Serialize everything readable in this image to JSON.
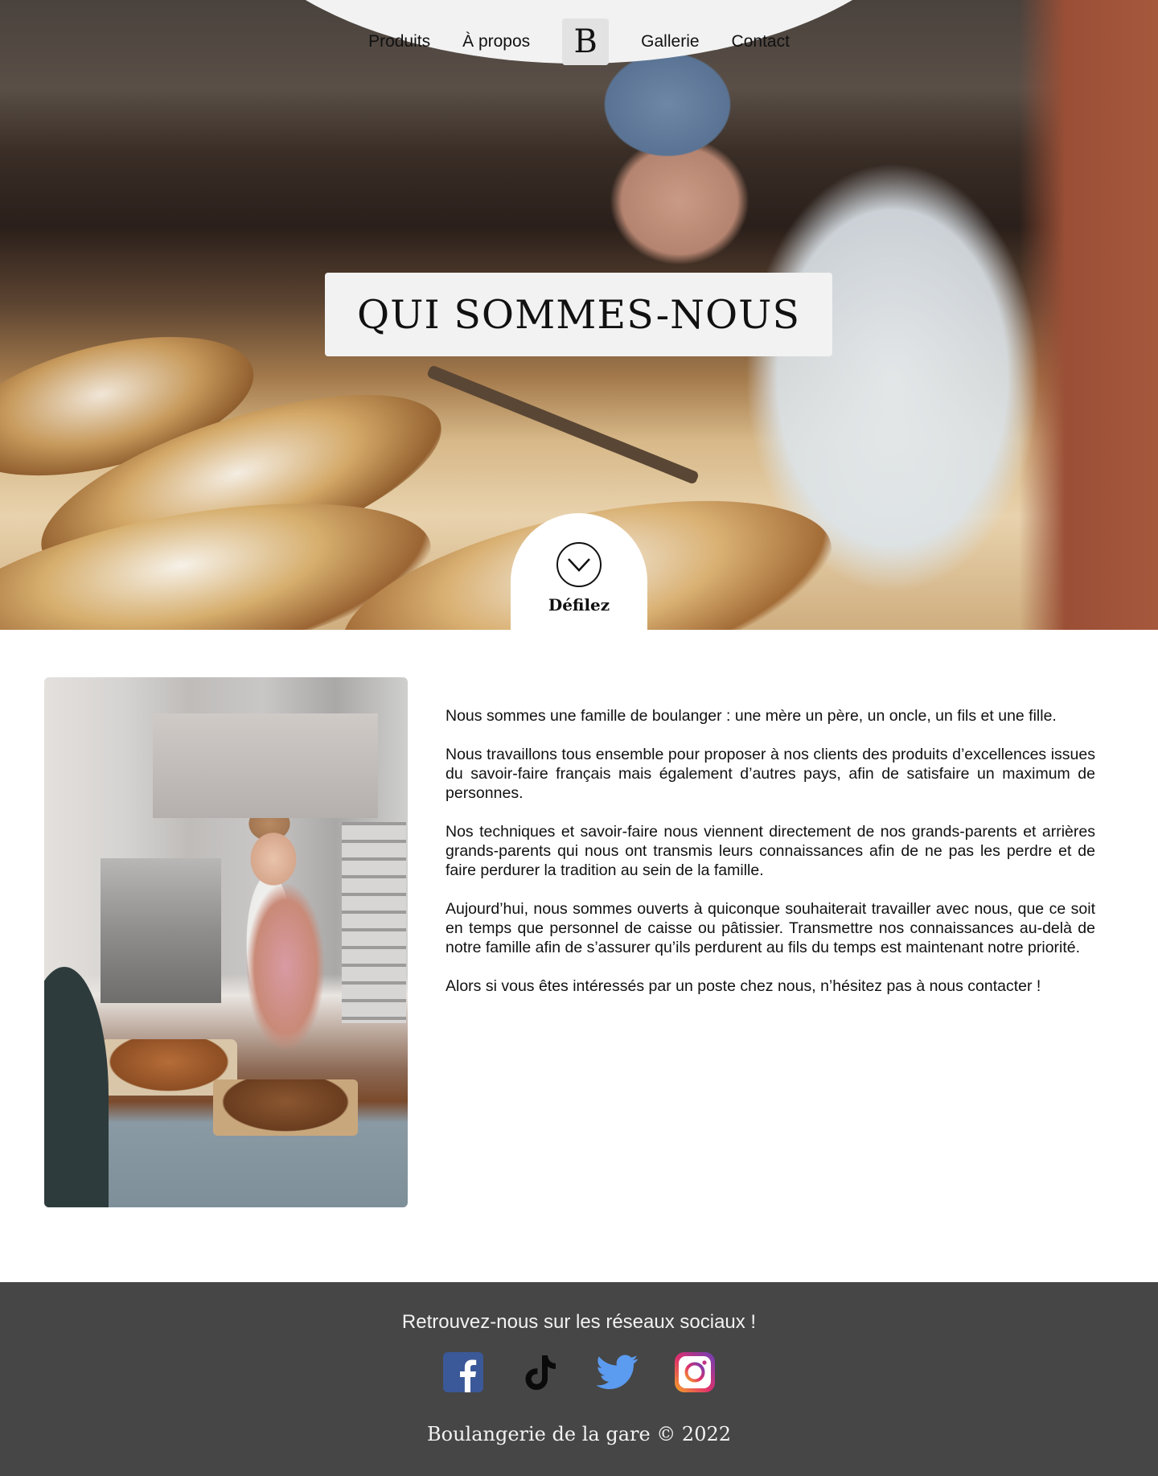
{
  "nav": {
    "items": [
      "Produits",
      "À propos",
      "Gallerie",
      "Contact"
    ],
    "logo": "B"
  },
  "hero": {
    "title": "QUI SOMMES-NOUS",
    "scroll_label": "Défilez"
  },
  "about": {
    "paragraphs": [
      "Nous sommes une famille de boulanger : une mère un père, un oncle, un fils et une fille.",
      "Nous travaillons tous ensemble pour proposer à nos clients des produits d’excellences issues du savoir-faire français mais également d’autres pays, afin de satisfaire un maximum de personnes.",
      "Nos techniques et savoir-faire nous viennent directement de nos grands-parents et arrières grands-parents qui nous ont transmis leurs connaissances afin de ne pas les perdre et de faire perdurer la tradition au sein de la famille.",
      "Aujourd’hui, nous sommes ouverts à quiconque souhaiterait travailler avec nous, que ce soit en temps que personnel de caisse ou pâtissier. Transmettre nos connaissances au-delà de notre famille afin de s’assurer qu’ils perdurent au fils du temps est maintenant notre priorité.",
      "Alors si vous êtes intéressés par un poste chez nous, n’hésitez pas à nous contacter !"
    ]
  },
  "footer": {
    "social_title": "Retrouvez-nous sur les réseaux sociaux !",
    "social_icons": [
      "facebook-icon",
      "tiktok-icon",
      "twitter-icon",
      "instagram-icon"
    ],
    "copyright": "Boulangerie de la gare © 2022"
  },
  "colors": {
    "nav_bg": "#f2f2f2",
    "footer_bg": "#464646",
    "facebook": "#3b5998",
    "twitter": "#5b9bf0"
  }
}
